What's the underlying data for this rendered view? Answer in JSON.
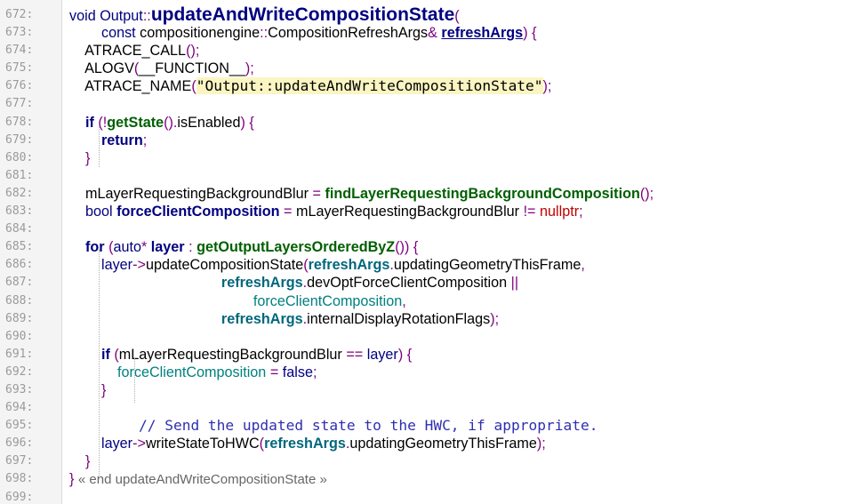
{
  "lines": [
    {
      "n": "672:",
      "segs": [
        {
          "t": "void ",
          "c": "ty t"
        },
        {
          "t": "Output",
          "c": "ty t"
        },
        {
          "t": "::",
          "c": "pu t"
        },
        {
          "t": "updateAndWriteCompositionState",
          "c": "big t"
        },
        {
          "t": "(",
          "c": "pu t"
        }
      ]
    },
    {
      "n": "673:",
      "segs": [
        {
          "t": "        const ",
          "c": "ty t"
        },
        {
          "t": "compositionengine",
          "c": "t"
        },
        {
          "t": "::",
          "c": "pu t"
        },
        {
          "t": "CompositionRefreshArgs",
          "c": "t"
        },
        {
          "t": "& ",
          "c": "pu t"
        },
        {
          "t": "refreshArgs",
          "c": "ul t"
        },
        {
          "t": ") {",
          "c": "pu t"
        }
      ]
    },
    {
      "n": "674:",
      "segs": [
        {
          "t": "    ATRACE_CALL",
          "c": "t"
        },
        {
          "t": "();",
          "c": "pu t"
        }
      ]
    },
    {
      "n": "675:",
      "segs": [
        {
          "t": "    ALOGV",
          "c": "t"
        },
        {
          "t": "(",
          "c": "pu t"
        },
        {
          "t": "__FUNCTION__",
          "c": "t"
        },
        {
          "t": ");",
          "c": "pu t"
        }
      ]
    },
    {
      "n": "676:",
      "segs": [
        {
          "t": "    ATRACE_NAME",
          "c": "t"
        },
        {
          "t": "(",
          "c": "pu t"
        },
        {
          "t": "\"Output::updateAndWriteCompositionState\"",
          "c": "hl m"
        },
        {
          "t": ");",
          "c": "pu t"
        }
      ]
    },
    {
      "n": "677:",
      "segs": []
    },
    {
      "n": "678:",
      "segs": [
        {
          "t": "    if ",
          "c": "kw t"
        },
        {
          "t": "(!",
          "c": "pu t"
        },
        {
          "t": "getState",
          "c": "fn t"
        },
        {
          "t": "().",
          "c": "pu t"
        },
        {
          "t": "isEnabled",
          "c": "t"
        },
        {
          "t": ") {",
          "c": "pu t"
        }
      ]
    },
    {
      "n": "679:",
      "segs": [
        {
          "t": "        return",
          "c": "kw t"
        },
        {
          "t": ";",
          "c": "pu t"
        }
      ]
    },
    {
      "n": "680:",
      "segs": [
        {
          "t": "    }",
          "c": "pu t"
        }
      ]
    },
    {
      "n": "681:",
      "segs": []
    },
    {
      "n": "682:",
      "segs": [
        {
          "t": "    mLayerRequestingBackgroundBlur ",
          "c": "t"
        },
        {
          "t": "= ",
          "c": "pu t"
        },
        {
          "t": "findLayerRequestingBackgroundComposition",
          "c": "fn t"
        },
        {
          "t": "();",
          "c": "pu t"
        }
      ]
    },
    {
      "n": "683:",
      "segs": [
        {
          "t": "    bool ",
          "c": "ty t"
        },
        {
          "t": "forceClientComposition",
          "c": "kw t"
        },
        {
          "t": " = ",
          "c": "pu t"
        },
        {
          "t": "mLayerRequestingBackgroundBlur ",
          "c": "t"
        },
        {
          "t": "!= ",
          "c": "pu t"
        },
        {
          "t": "nullptr",
          "c": "nu t"
        },
        {
          "t": ";",
          "c": "pu t"
        }
      ]
    },
    {
      "n": "684:",
      "segs": []
    },
    {
      "n": "685:",
      "segs": [
        {
          "t": "    for ",
          "c": "kw t"
        },
        {
          "t": "(",
          "c": "pu t"
        },
        {
          "t": "auto",
          "c": "ty t"
        },
        {
          "t": "* ",
          "c": "pu t"
        },
        {
          "t": "layer",
          "c": "kw t"
        },
        {
          "t": " : ",
          "c": "pu t"
        },
        {
          "t": "getOutputLayersOrderedByZ",
          "c": "fn t"
        },
        {
          "t": "()) {",
          "c": "pu t"
        }
      ]
    },
    {
      "n": "686:",
      "segs": [
        {
          "t": "        layer",
          "c": "ty t"
        },
        {
          "t": "->",
          "c": "pu t"
        },
        {
          "t": "updateCompositionState",
          "c": "t"
        },
        {
          "t": "(",
          "c": "pu t"
        },
        {
          "t": "refreshArgs",
          "c": "fc t"
        },
        {
          "t": ".",
          "c": "pu t"
        },
        {
          "t": "updatingGeometryThisFrame",
          "c": "t"
        },
        {
          "t": ",",
          "c": "pu t"
        }
      ]
    },
    {
      "n": "687:",
      "segs": [
        {
          "t": "                                      refreshArgs",
          "c": "fc t"
        },
        {
          "t": ".",
          "c": "pu t"
        },
        {
          "t": "devOptForceClientComposition ",
          "c": "t"
        },
        {
          "t": "||",
          "c": "pu t"
        }
      ]
    },
    {
      "n": "688:",
      "segs": [
        {
          "t": "                                              forceClientComposition",
          "c": "cyan t"
        },
        {
          "t": ",",
          "c": "pu t"
        }
      ]
    },
    {
      "n": "689:",
      "segs": [
        {
          "t": "                                      refreshArgs",
          "c": "fc t"
        },
        {
          "t": ".",
          "c": "pu t"
        },
        {
          "t": "internalDisplayRotationFlags",
          "c": "t"
        },
        {
          "t": ");",
          "c": "pu t"
        }
      ]
    },
    {
      "n": "690:",
      "segs": []
    },
    {
      "n": "691:",
      "segs": [
        {
          "t": "        if ",
          "c": "kw t"
        },
        {
          "t": "(",
          "c": "pu t"
        },
        {
          "t": "mLayerRequestingBackgroundBlur ",
          "c": "t"
        },
        {
          "t": "== ",
          "c": "pu t"
        },
        {
          "t": "layer",
          "c": "ty t"
        },
        {
          "t": ") {",
          "c": "pu t"
        }
      ]
    },
    {
      "n": "692:",
      "segs": [
        {
          "t": "            forceClientComposition",
          "c": "cyan t"
        },
        {
          "t": " = ",
          "c": "pu t"
        },
        {
          "t": "false",
          "c": "ty t"
        },
        {
          "t": ";",
          "c": "pu t"
        }
      ]
    },
    {
      "n": "693:",
      "segs": [
        {
          "t": "        }",
          "c": "pu t"
        }
      ]
    },
    {
      "n": "694:",
      "segs": []
    },
    {
      "n": "695:",
      "segs": [
        {
          "t": "        // Send the updated state to the HWC, if appropriate.",
          "c": "cm m"
        }
      ]
    },
    {
      "n": "696:",
      "segs": [
        {
          "t": "        layer",
          "c": "ty t"
        },
        {
          "t": "->",
          "c": "pu t"
        },
        {
          "t": "writeStateToHWC",
          "c": "t"
        },
        {
          "t": "(",
          "c": "pu t"
        },
        {
          "t": "refreshArgs",
          "c": "fc t"
        },
        {
          "t": ".",
          "c": "pu t"
        },
        {
          "t": "updatingGeometryThisFrame",
          "c": "t"
        },
        {
          "t": ");",
          "c": "pu t"
        }
      ]
    },
    {
      "n": "697:",
      "segs": [
        {
          "t": "    }",
          "c": "pu t"
        }
      ]
    },
    {
      "n": "698:",
      "segs": [
        {
          "t": "} ",
          "c": "pu t"
        },
        {
          "t": "« end updateAndWriteCompositionState »",
          "c": "foldtxt t"
        }
      ]
    },
    {
      "n": "699:",
      "segs": []
    }
  ]
}
